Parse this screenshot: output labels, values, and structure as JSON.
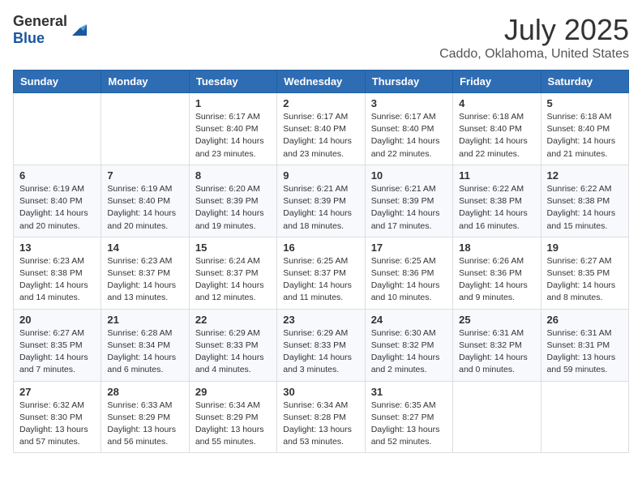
{
  "logo": {
    "general": "General",
    "blue": "Blue"
  },
  "title": "July 2025",
  "subtitle": "Caddo, Oklahoma, United States",
  "weekdays": [
    "Sunday",
    "Monday",
    "Tuesday",
    "Wednesday",
    "Thursday",
    "Friday",
    "Saturday"
  ],
  "weeks": [
    [
      {
        "day": "",
        "sunrise": "",
        "sunset": "",
        "daylight": ""
      },
      {
        "day": "",
        "sunrise": "",
        "sunset": "",
        "daylight": ""
      },
      {
        "day": "1",
        "sunrise": "Sunrise: 6:17 AM",
        "sunset": "Sunset: 8:40 PM",
        "daylight": "Daylight: 14 hours and 23 minutes."
      },
      {
        "day": "2",
        "sunrise": "Sunrise: 6:17 AM",
        "sunset": "Sunset: 8:40 PM",
        "daylight": "Daylight: 14 hours and 23 minutes."
      },
      {
        "day": "3",
        "sunrise": "Sunrise: 6:17 AM",
        "sunset": "Sunset: 8:40 PM",
        "daylight": "Daylight: 14 hours and 22 minutes."
      },
      {
        "day": "4",
        "sunrise": "Sunrise: 6:18 AM",
        "sunset": "Sunset: 8:40 PM",
        "daylight": "Daylight: 14 hours and 22 minutes."
      },
      {
        "day": "5",
        "sunrise": "Sunrise: 6:18 AM",
        "sunset": "Sunset: 8:40 PM",
        "daylight": "Daylight: 14 hours and 21 minutes."
      }
    ],
    [
      {
        "day": "6",
        "sunrise": "Sunrise: 6:19 AM",
        "sunset": "Sunset: 8:40 PM",
        "daylight": "Daylight: 14 hours and 20 minutes."
      },
      {
        "day": "7",
        "sunrise": "Sunrise: 6:19 AM",
        "sunset": "Sunset: 8:40 PM",
        "daylight": "Daylight: 14 hours and 20 minutes."
      },
      {
        "day": "8",
        "sunrise": "Sunrise: 6:20 AM",
        "sunset": "Sunset: 8:39 PM",
        "daylight": "Daylight: 14 hours and 19 minutes."
      },
      {
        "day": "9",
        "sunrise": "Sunrise: 6:21 AM",
        "sunset": "Sunset: 8:39 PM",
        "daylight": "Daylight: 14 hours and 18 minutes."
      },
      {
        "day": "10",
        "sunrise": "Sunrise: 6:21 AM",
        "sunset": "Sunset: 8:39 PM",
        "daylight": "Daylight: 14 hours and 17 minutes."
      },
      {
        "day": "11",
        "sunrise": "Sunrise: 6:22 AM",
        "sunset": "Sunset: 8:38 PM",
        "daylight": "Daylight: 14 hours and 16 minutes."
      },
      {
        "day": "12",
        "sunrise": "Sunrise: 6:22 AM",
        "sunset": "Sunset: 8:38 PM",
        "daylight": "Daylight: 14 hours and 15 minutes."
      }
    ],
    [
      {
        "day": "13",
        "sunrise": "Sunrise: 6:23 AM",
        "sunset": "Sunset: 8:38 PM",
        "daylight": "Daylight: 14 hours and 14 minutes."
      },
      {
        "day": "14",
        "sunrise": "Sunrise: 6:23 AM",
        "sunset": "Sunset: 8:37 PM",
        "daylight": "Daylight: 14 hours and 13 minutes."
      },
      {
        "day": "15",
        "sunrise": "Sunrise: 6:24 AM",
        "sunset": "Sunset: 8:37 PM",
        "daylight": "Daylight: 14 hours and 12 minutes."
      },
      {
        "day": "16",
        "sunrise": "Sunrise: 6:25 AM",
        "sunset": "Sunset: 8:37 PM",
        "daylight": "Daylight: 14 hours and 11 minutes."
      },
      {
        "day": "17",
        "sunrise": "Sunrise: 6:25 AM",
        "sunset": "Sunset: 8:36 PM",
        "daylight": "Daylight: 14 hours and 10 minutes."
      },
      {
        "day": "18",
        "sunrise": "Sunrise: 6:26 AM",
        "sunset": "Sunset: 8:36 PM",
        "daylight": "Daylight: 14 hours and 9 minutes."
      },
      {
        "day": "19",
        "sunrise": "Sunrise: 6:27 AM",
        "sunset": "Sunset: 8:35 PM",
        "daylight": "Daylight: 14 hours and 8 minutes."
      }
    ],
    [
      {
        "day": "20",
        "sunrise": "Sunrise: 6:27 AM",
        "sunset": "Sunset: 8:35 PM",
        "daylight": "Daylight: 14 hours and 7 minutes."
      },
      {
        "day": "21",
        "sunrise": "Sunrise: 6:28 AM",
        "sunset": "Sunset: 8:34 PM",
        "daylight": "Daylight: 14 hours and 6 minutes."
      },
      {
        "day": "22",
        "sunrise": "Sunrise: 6:29 AM",
        "sunset": "Sunset: 8:33 PM",
        "daylight": "Daylight: 14 hours and 4 minutes."
      },
      {
        "day": "23",
        "sunrise": "Sunrise: 6:29 AM",
        "sunset": "Sunset: 8:33 PM",
        "daylight": "Daylight: 14 hours and 3 minutes."
      },
      {
        "day": "24",
        "sunrise": "Sunrise: 6:30 AM",
        "sunset": "Sunset: 8:32 PM",
        "daylight": "Daylight: 14 hours and 2 minutes."
      },
      {
        "day": "25",
        "sunrise": "Sunrise: 6:31 AM",
        "sunset": "Sunset: 8:32 PM",
        "daylight": "Daylight: 14 hours and 0 minutes."
      },
      {
        "day": "26",
        "sunrise": "Sunrise: 6:31 AM",
        "sunset": "Sunset: 8:31 PM",
        "daylight": "Daylight: 13 hours and 59 minutes."
      }
    ],
    [
      {
        "day": "27",
        "sunrise": "Sunrise: 6:32 AM",
        "sunset": "Sunset: 8:30 PM",
        "daylight": "Daylight: 13 hours and 57 minutes."
      },
      {
        "day": "28",
        "sunrise": "Sunrise: 6:33 AM",
        "sunset": "Sunset: 8:29 PM",
        "daylight": "Daylight: 13 hours and 56 minutes."
      },
      {
        "day": "29",
        "sunrise": "Sunrise: 6:34 AM",
        "sunset": "Sunset: 8:29 PM",
        "daylight": "Daylight: 13 hours and 55 minutes."
      },
      {
        "day": "30",
        "sunrise": "Sunrise: 6:34 AM",
        "sunset": "Sunset: 8:28 PM",
        "daylight": "Daylight: 13 hours and 53 minutes."
      },
      {
        "day": "31",
        "sunrise": "Sunrise: 6:35 AM",
        "sunset": "Sunset: 8:27 PM",
        "daylight": "Daylight: 13 hours and 52 minutes."
      },
      {
        "day": "",
        "sunrise": "",
        "sunset": "",
        "daylight": ""
      },
      {
        "day": "",
        "sunrise": "",
        "sunset": "",
        "daylight": ""
      }
    ]
  ]
}
